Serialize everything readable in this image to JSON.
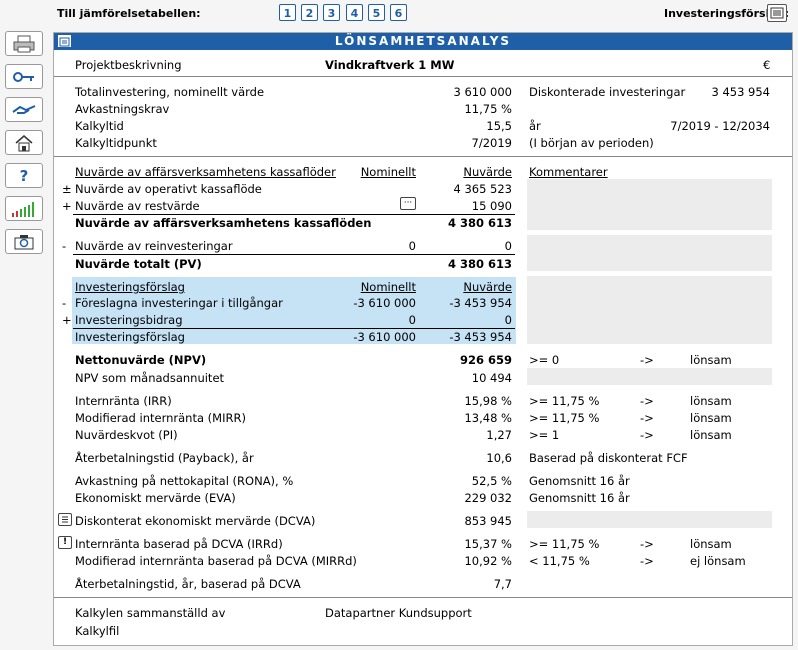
{
  "top": {
    "compare_label": "Till jämförelsetabellen:",
    "compare_buttons": [
      "1",
      "2",
      "3",
      "4",
      "5",
      "6"
    ],
    "proposal_label": "Investeringsförslag:"
  },
  "sidebar": {
    "items": [
      {
        "name": "print-icon"
      },
      {
        "name": "key-icon"
      },
      {
        "name": "handshake-icon"
      },
      {
        "name": "home-icon"
      },
      {
        "name": "help-icon",
        "glyph": "?"
      },
      {
        "name": "chart-icon"
      },
      {
        "name": "camera-icon"
      }
    ]
  },
  "title": "LÖNSAMHETSANALYS",
  "project": {
    "label": "Projektbeskrivning",
    "value": "Vindkraftverk 1 MW",
    "currency": "€"
  },
  "invest": {
    "rows": [
      {
        "label": "Totalinvestering, nominellt värde",
        "value": "3 610 000"
      },
      {
        "label": "Avkastningskrav",
        "value": "11,75 %"
      },
      {
        "label": "Kalkyltid",
        "value": "15,5"
      },
      {
        "label": "Kalkyltidpunkt",
        "value": "7/2019"
      }
    ],
    "disc_label": "Diskonterade investeringar",
    "disc_value": "3 453 954",
    "unit_year": "år",
    "period": "7/2019 - 12/2034",
    "period_note": "(I början av perioden)"
  },
  "cashflow": {
    "header": "Nuvärde av affärsverksamhetens kassaflöder",
    "col_nominal": "Nominellt",
    "col_pv": "Nuvärde",
    "col_comments": "Kommentarer",
    "op_sign": "±",
    "op_label": "Nuvärde av operativt kassaflöde",
    "op_value": "4 365 523",
    "rest_sign": "+",
    "rest_label": "Nuvärde av restvärde",
    "rest_btn": "···",
    "rest_value": "15 090",
    "sum_label": "Nuvärde av affärsverksamhetens kassaflöden",
    "sum_value": "4 380 613",
    "reinv_sign": "-",
    "reinv_label": "Nuvärde av reinvesteringar",
    "reinv_nominal": "0",
    "reinv_value": "0",
    "total_label": "Nuvärde totalt (PV)",
    "total_value": "4 380 613"
  },
  "proposal": {
    "header": "Investeringsförslag",
    "col_nominal": "Nominellt",
    "col_pv": "Nuvärde",
    "r1_sign": "-",
    "r1_label": "Föreslagna investeringar i tillgångar",
    "r1_nominal": "-3 610 000",
    "r1_pv": "-3 453 954",
    "r2_sign": "+",
    "r2_label": "Investeringsbidrag",
    "r2_nominal": "0",
    "r2_pv": "0",
    "sum_label": "Investeringsförslag",
    "sum_nominal": "-3 610 000",
    "sum_pv": "-3 453 954"
  },
  "results": {
    "npv": {
      "label": "Nettonuvärde (NPV)",
      "value": "926 659",
      "cond": ">= 0",
      "arrow": "->",
      "verdict": "lönsam"
    },
    "annuity": {
      "label": "NPV som månadsannuitet",
      "value": "10 494"
    },
    "irr": {
      "label": "Internränta (IRR)",
      "value": "15,98 %",
      "cond": ">= 11,75 %",
      "arrow": "->",
      "verdict": "lönsam"
    },
    "mirr": {
      "label": "Modifierad internränta (MIRR)",
      "value": "13,48 %",
      "cond": ">= 11,75 %",
      "arrow": "->",
      "verdict": "lönsam"
    },
    "pi": {
      "label": "Nuvärdeskvot (PI)",
      "value": "1,27",
      "cond": ">= 1",
      "arrow": "->",
      "verdict": "lönsam"
    },
    "payback": {
      "label": "Återbetalningstid (Payback), år",
      "value": "10,6",
      "note": "Baserad på diskonterat FCF"
    },
    "rona": {
      "label": "Avkastning på nettokapital (RONA), %",
      "value": "52,5 %",
      "note": "Genomsnitt 16 år"
    },
    "eva": {
      "label": "Ekonomiskt mervärde (EVA)",
      "value": "229 032",
      "note": "Genomsnitt 16 år"
    },
    "dcva": {
      "label": "Diskonterat ekonomiskt mervärde (DCVA)",
      "value": "853 945"
    },
    "irrd": {
      "label": "Internränta baserad på DCVA (IRRd)",
      "value": "15,37 %",
      "cond": ">= 11,75 %",
      "arrow": "->",
      "verdict": "lönsam"
    },
    "mirrd": {
      "label": "Modifierad internränta baserad på DCVA (MIRRd)",
      "value": "10,92 %",
      "cond": "< 11,75 %",
      "arrow": "->",
      "verdict": "ej lönsam"
    },
    "paybackd": {
      "label": "Återbetalningstid, år, baserad på DCVA",
      "value": "7,7"
    }
  },
  "footer": {
    "compiled_label": "Kalkylen sammanställd av",
    "compiled_value": "Datapartner Kundsupport",
    "file_label": "Kalkylfil"
  }
}
